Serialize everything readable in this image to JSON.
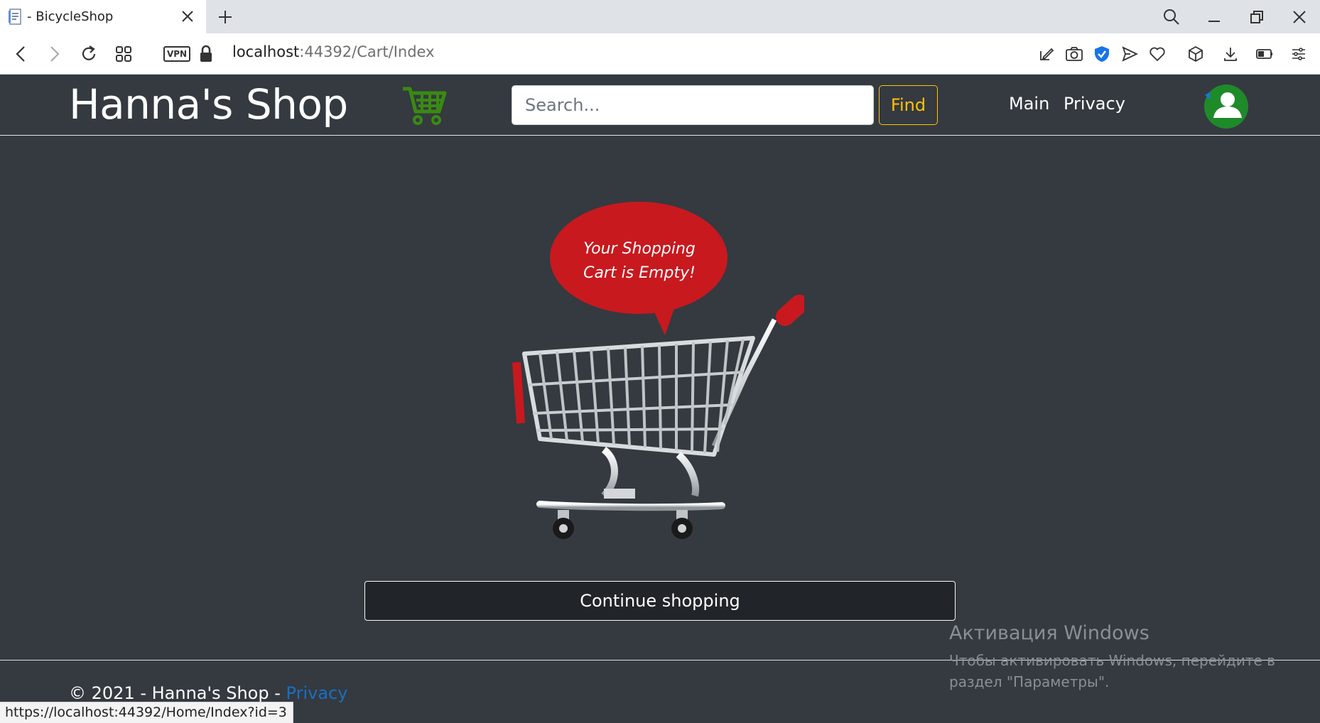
{
  "browser": {
    "tab_title": "- BicycleShop",
    "url_host": "localhost",
    "url_path": ":44392/Cart/Index",
    "vpn_label": "VPN",
    "status_url": "https://localhost:44392/Home/Index?id=3"
  },
  "site": {
    "brand": "Hanna's Shop",
    "search_placeholder": "Search...",
    "find_label": "Find",
    "nav": [
      "Main",
      "Privacy"
    ],
    "cart_icon": "shopping-cart-icon",
    "cart_icon_color": "#3a8a12",
    "avatar_icon": "user-avatar-icon",
    "avatar_color": "#1f8a2a",
    "accent_color": "#ffc107"
  },
  "main": {
    "bubble_line1": "Your Shopping",
    "bubble_line2": "Cart is Empty!",
    "continue_label": "Continue shopping"
  },
  "footer": {
    "copyright": "© 2021 - Hanna's Shop - ",
    "privacy_link": "Privacy"
  },
  "windows_activation": {
    "title": "Активация Windows",
    "subtitle": "Чтобы активировать Windows, перейдите в раздел \"Параметры\"."
  }
}
